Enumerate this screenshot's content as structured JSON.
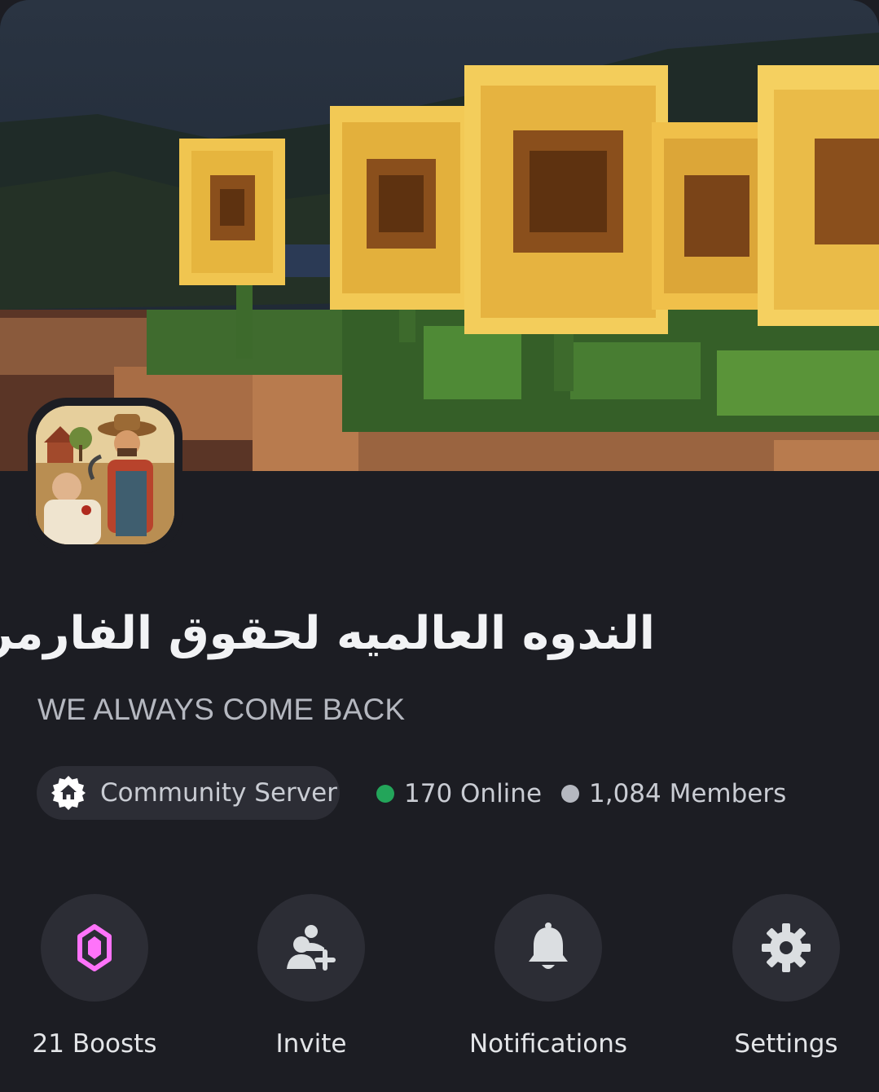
{
  "server": {
    "name": "الندوه العالميه لحقوق الفارمرز",
    "tagline": "WE ALWAYS COME BACK",
    "banner_icon": "sunflower-banner-image",
    "avatar_icon": "farmer-avatar-image"
  },
  "info": {
    "community_label": "Community Server",
    "community_icon": "community-home-icon",
    "online_text": "170 Online",
    "members_text": "1,084 Members",
    "online_color": "#23a55a",
    "members_color": "#b5b8c0"
  },
  "actions": {
    "boosts": {
      "label": "21 Boosts",
      "icon": "boost-gem-icon",
      "accent": "#ff73fa"
    },
    "invite": {
      "label": "Invite",
      "icon": "add-user-icon"
    },
    "notifications": {
      "label": "Notifications",
      "icon": "bell-icon"
    },
    "settings": {
      "label": "Settings",
      "icon": "gear-icon"
    }
  },
  "colors": {
    "background": "#1c1d23",
    "surface": "#2c2d35",
    "text_primary": "#f2f3f5",
    "text_secondary": "#b5b8c0"
  }
}
